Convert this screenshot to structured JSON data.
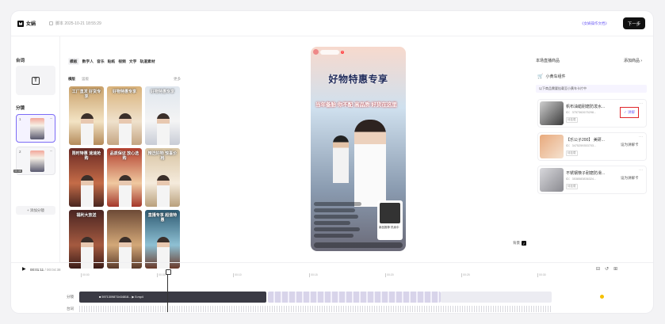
{
  "header": {
    "logo_text": "女娲",
    "doc_title": "脚本 2025-10-21 18:55:29",
    "tutorial_link": "《女娲操作文档》",
    "next_button": "下一步"
  },
  "left_panel": {
    "title_section": "台词",
    "title_icon": "T",
    "shots_section": "分镜",
    "shots": [
      {
        "num": "1",
        "duration": "",
        "active": true
      },
      {
        "num": "2",
        "duration": "00:08",
        "active": false
      }
    ],
    "add_shot": "+ 添加分镜"
  },
  "materials": {
    "categories": [
      "模板",
      "数字人",
      "音乐",
      "贴纸",
      "视频",
      "文字",
      "轨道素材"
    ],
    "active_category": "模板",
    "subtabs": [
      "横版",
      "竖版"
    ],
    "more": "更多",
    "templates": [
      {
        "caption": "工厂直发 好货专享",
        "bg": "linear-gradient(180deg,#c9a16a,#f3e3c4 60%,#b48a5a)"
      },
      {
        "caption": "好物特惠专享",
        "bg": "linear-gradient(180deg,#d9b27a,#efe1cc 60%,#c4a582)"
      },
      {
        "caption": "好物特惠专享",
        "bg": "linear-gradient(180deg,#dfe6ee,#f4f4f4 60%,#c8ccd6)"
      },
      {
        "caption": "限时特惠 速速抢购",
        "bg": "linear-gradient(180deg,#6a2a24,#c56c48 60%,#4a2620)"
      },
      {
        "caption": "品质保证 放心选购",
        "bg": "linear-gradient(180deg,#b3402f,#f0c9a0 60%,#a4372a)"
      },
      {
        "caption": "精选好物 惊喜价格",
        "bg": "linear-gradient(180deg,#d8c4a3,#f5ebdc 60%,#b9a07c)"
      },
      {
        "caption": "福利大放送",
        "bg": "linear-gradient(180deg,#4a2522,#a55a40 60%,#3a1c18)"
      },
      {
        "caption": "",
        "bg": "linear-gradient(180deg,#6d4a36,#d3a878 60%,#5a3a2a)"
      },
      {
        "caption": "直播专享 超值特惠",
        "bg": "linear-gradient(180deg,#2e5a72,#8ec0d3 60%,#6a3a2a)"
      }
    ]
  },
  "preview": {
    "title": "好物特惠专享",
    "slogan": "当年备胎 你不配 高品质 好货在这里",
    "product_card": "新品推荐 热卖中",
    "background_toggle": "背景"
  },
  "right_panel": {
    "title": "本场直播商品",
    "add_link": "添加商品 ›",
    "cart_label": "小黄车组件",
    "tip": "以下商品需要挂载至小黄车卡片中",
    "products": [
      {
        "name": "帆布油蜡耐磨防泼水...",
        "id": "ID：3757362675298...",
        "state": "待挂载",
        "action": "✓ 讲解",
        "done": true,
        "img": "linear-gradient(135deg,#cfcfcf,#3a3a3a)"
      },
      {
        "name": "【乐公子200】 美研...",
        "id": "ID：3475259353703...",
        "state": "待挂载",
        "action": "设为讲解卡",
        "done": false,
        "img": "linear-gradient(135deg,#e8a97c,#f5e2d0)"
      },
      {
        "name": "不锈钢筷子耐磨防滑...",
        "id": "ID：3538583836324...",
        "state": "待挂载",
        "action": "设为讲解卡",
        "done": false,
        "img": "linear-gradient(135deg,#d8d8dc,#8a8a90)"
      }
    ]
  },
  "timeline": {
    "current": "00:01:11",
    "total": "/ 00:04:38",
    "ticks": [
      "00:00",
      "00:05",
      "00:10",
      "00:15",
      "00:20",
      "00:25",
      "00:30"
    ],
    "track_video_label": "分镜",
    "track_audio_label": "台词",
    "clip_label": "■ 5971309871b34818...   ▶ 5.mp4"
  }
}
